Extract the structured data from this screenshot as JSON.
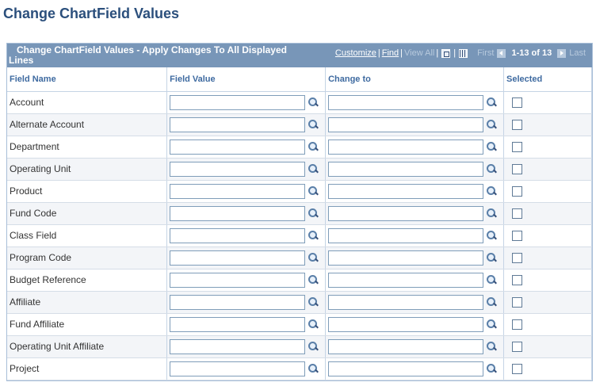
{
  "page": {
    "title": "Change ChartField Values"
  },
  "grid": {
    "title": "Change ChartField Values - Apply Changes To All Displayed Lines",
    "nav": {
      "customize": "Customize",
      "find": "Find",
      "view_all": "View All",
      "first": "First",
      "count": "1-13 of 13",
      "last": "Last",
      "icons": [
        "zoom-icon",
        "grid-download-icon",
        "first-arrow-icon",
        "last-arrow-icon"
      ]
    },
    "columns": [
      "Field Name",
      "Field Value",
      "Change to",
      "Selected"
    ],
    "rows": [
      {
        "field": "Account",
        "value": "",
        "change": "",
        "selected": false
      },
      {
        "field": "Alternate Account",
        "value": "",
        "change": "",
        "selected": false
      },
      {
        "field": "Department",
        "value": "",
        "change": "",
        "selected": false
      },
      {
        "field": "Operating Unit",
        "value": "",
        "change": "",
        "selected": false
      },
      {
        "field": "Product",
        "value": "",
        "change": "",
        "selected": false
      },
      {
        "field": "Fund Code",
        "value": "",
        "change": "",
        "selected": false
      },
      {
        "field": "Class Field",
        "value": "",
        "change": "",
        "selected": false
      },
      {
        "field": "Program Code",
        "value": "",
        "change": "",
        "selected": false
      },
      {
        "field": "Budget Reference",
        "value": "",
        "change": "",
        "selected": false
      },
      {
        "field": "Affiliate",
        "value": "",
        "change": "",
        "selected": false
      },
      {
        "field": "Fund Affiliate",
        "value": "",
        "change": "",
        "selected": false
      },
      {
        "field": "Operating Unit Affiliate",
        "value": "",
        "change": "",
        "selected": false
      },
      {
        "field": "Project",
        "value": "",
        "change": "",
        "selected": false
      }
    ]
  },
  "colors": {
    "header_bg": "#7896b8",
    "title_color": "#2b4f7c",
    "column_header_color": "#3e6aa0"
  }
}
